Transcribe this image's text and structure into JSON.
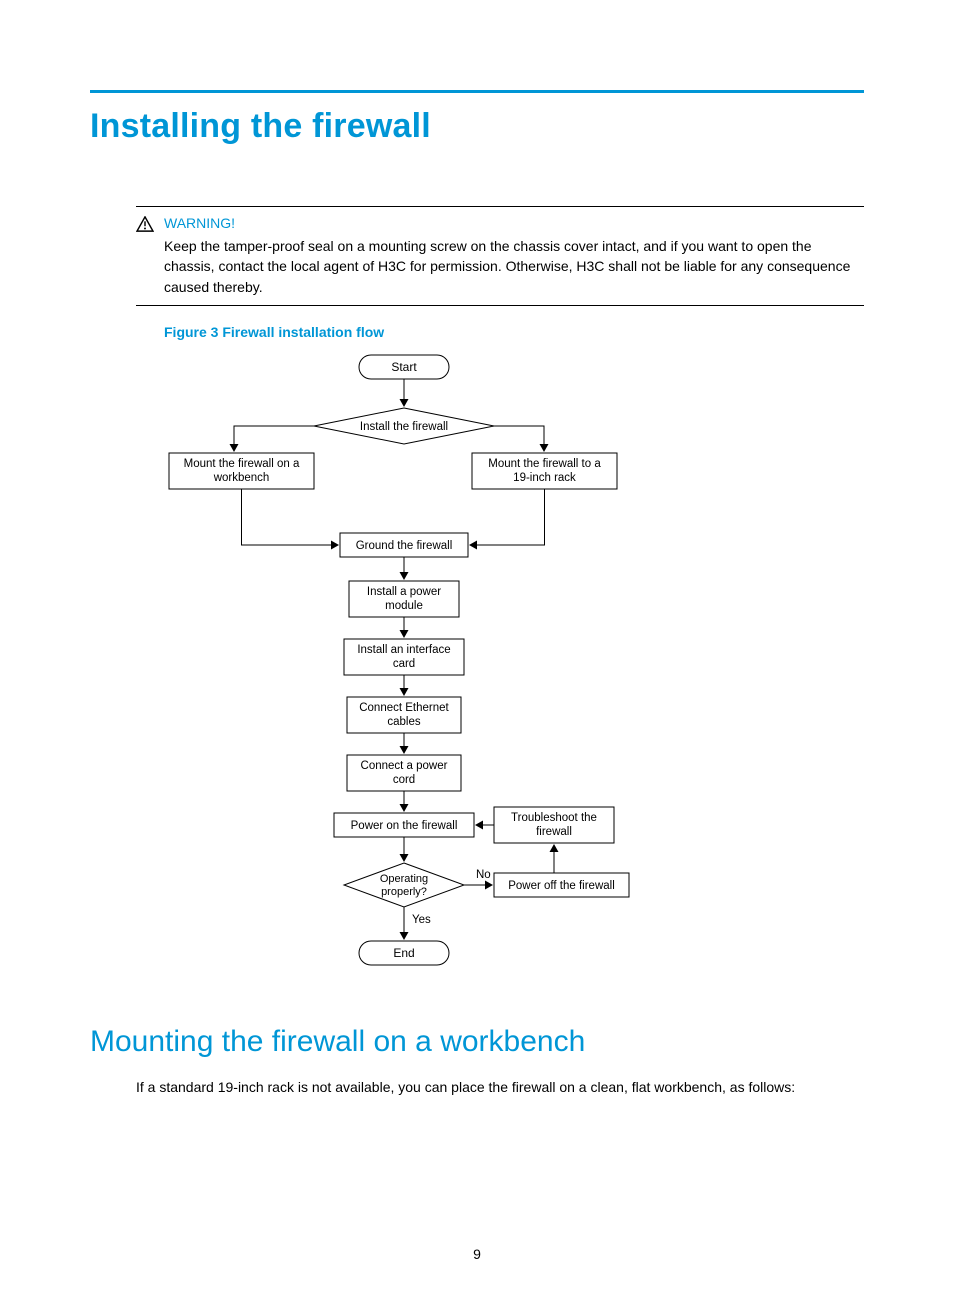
{
  "title": "Installing the firewall",
  "warning": {
    "label": "WARNING!",
    "text": "Keep the tamper-proof seal on a mounting screw on the chassis cover intact, and if you want to open the chassis, contact the local agent of H3C for permission. Otherwise, H3C shall not be liable for any consequence caused thereby."
  },
  "figure_caption": "Figure 3 Firewall installation flow",
  "flow": {
    "start": "Start",
    "install": "Install the firewall",
    "mount_wb_l1": "Mount the firewall on a",
    "mount_wb_l2": "workbench",
    "mount_rack_l1": "Mount the firewall to a",
    "mount_rack_l2": "19-inch rack",
    "ground": "Ground the firewall",
    "power_mod_l1": "Install a power",
    "power_mod_l2": "module",
    "iface_l1": "Install an interface",
    "iface_l2": "card",
    "eth_l1": "Connect Ethernet",
    "eth_l2": "cables",
    "pcord_l1": "Connect a power",
    "pcord_l2": "cord",
    "power_on": "Power on the firewall",
    "troubleshoot_l1": "Troubleshoot the",
    "troubleshoot_l2": "firewall",
    "op_l1": "Operating",
    "op_l2": "properly?",
    "no": "No",
    "yes": "Yes",
    "power_off": "Power off the firewall",
    "end": "End"
  },
  "subheading": "Mounting the firewall on a workbench",
  "body": "If a standard 19-inch rack is not available, you can place the firewall on a clean, flat workbench, as follows:",
  "page_number": "9"
}
